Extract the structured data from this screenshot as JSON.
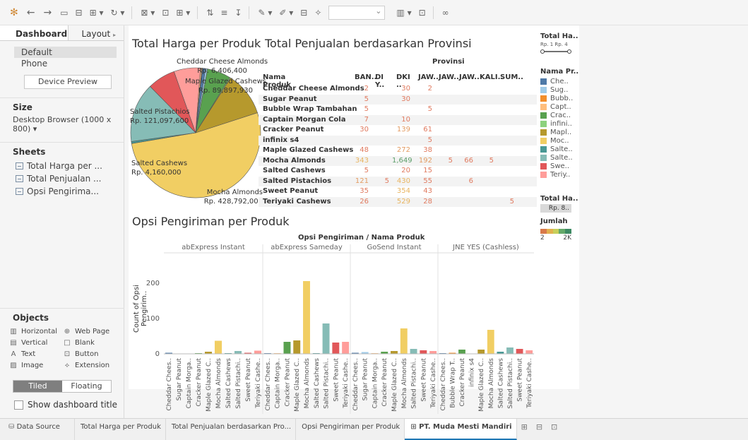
{
  "toolbar": {
    "icons": [
      "tableau-logo-icon",
      "back-icon",
      "forward-icon",
      "save-icon",
      "new-datasource-icon",
      "new-sheet-icon",
      "refresh-icon",
      "present-icon",
      "device-icon",
      "sort-icon",
      "highlight-icon",
      "pen-icon",
      "fit-icon",
      "show-me-icon",
      "share-icon"
    ]
  },
  "leftpane": {
    "tabs": {
      "dashboard": "Dashboard",
      "layout": "Layout"
    },
    "devices": [
      "Default",
      "Phone"
    ],
    "preview_button": "Device Preview",
    "size_label": "Size",
    "size_value": "Desktop Browser (1000 x 800) ▾",
    "sheets_label": "Sheets",
    "sheets": [
      "Total Harga per ...",
      "Total Penjualan ...",
      "Opsi Pengirima..."
    ],
    "objects_label": "Objects",
    "objects": [
      {
        "glyph": "▥",
        "label": "Horizontal"
      },
      {
        "glyph": "⊕",
        "label": "Web Page"
      },
      {
        "glyph": "▤",
        "label": "Vertical"
      },
      {
        "glyph": "□",
        "label": "Blank"
      },
      {
        "glyph": "A",
        "label": "Text"
      },
      {
        "glyph": "⊡",
        "label": "Button"
      },
      {
        "glyph": "▨",
        "label": "Image"
      },
      {
        "glyph": "⟡",
        "label": "Extension"
      }
    ],
    "tiled": "Tiled",
    "floating": "Floating",
    "show_title": "Show dashboard title"
  },
  "pie": {
    "title": "Total Harga per Produk",
    "labels": [
      {
        "name": "Cheddar Cheese Almonds",
        "value": "Rp. 6,406,400"
      },
      {
        "name": "Maple Glazed Cashews",
        "value": "Rp. 89,897,930"
      },
      {
        "name": "Salted Pistachios",
        "value": "Rp. 121,097,600"
      },
      {
        "name": "Salted Cashews",
        "value": "Rp. 4,160,000"
      },
      {
        "name": "Mocha Almonds",
        "value": "Rp. 428,792,000"
      }
    ]
  },
  "table": {
    "title": "Total Penjualan berdasarkan Provinsi",
    "col_group": "Provinsi",
    "row_header": "Nama Produk",
    "columns": [
      "BAN..",
      "DI Y..",
      "DKI ..",
      "JAW..",
      "JAW..",
      "JAW..",
      "KALI..",
      "SUM.."
    ],
    "rows": [
      {
        "name": "Cheddar Cheese Almonds",
        "cells": [
          "2",
          "",
          "30",
          "2",
          "",
          "",
          "",
          ""
        ]
      },
      {
        "name": "Sugar Peanut",
        "cells": [
          "5",
          "",
          "30",
          "",
          "",
          "",
          "",
          ""
        ]
      },
      {
        "name": "Bubble Wrap Tambahan",
        "cells": [
          "5",
          "",
          "",
          "5",
          "",
          "",
          "",
          ""
        ]
      },
      {
        "name": "Captain Morgan Cola",
        "cells": [
          "7",
          "",
          "10",
          "",
          "",
          "",
          "",
          ""
        ]
      },
      {
        "name": "Cracker Peanut",
        "cells": [
          "30",
          "",
          "139",
          "61",
          "",
          "",
          "",
          ""
        ]
      },
      {
        "name": "infinix s4",
        "cells": [
          "",
          "",
          "",
          "5",
          "",
          "",
          "",
          ""
        ]
      },
      {
        "name": "Maple Glazed Cashews",
        "cells": [
          "48",
          "",
          "272",
          "38",
          "",
          "",
          "",
          ""
        ]
      },
      {
        "name": "Mocha Almonds",
        "cells": [
          "343",
          "",
          "1,649",
          "192",
          "5",
          "66",
          "5",
          ""
        ]
      },
      {
        "name": "Salted Cashews",
        "cells": [
          "5",
          "",
          "20",
          "15",
          "",
          "",
          "",
          ""
        ]
      },
      {
        "name": "Salted Pistachios",
        "cells": [
          "121",
          "5",
          "430",
          "55",
          "",
          "6",
          "",
          ""
        ]
      },
      {
        "name": "Sweet Peanut",
        "cells": [
          "35",
          "",
          "354",
          "43",
          "",
          "",
          "",
          ""
        ]
      },
      {
        "name": "Teriyaki Cashews",
        "cells": [
          "26",
          "",
          "529",
          "28",
          "",
          "",
          "",
          "5"
        ]
      }
    ]
  },
  "bar": {
    "title": "Opsi Pengiriman per Produk",
    "header": "Opsi Pengiriman / Nama Produk",
    "ylabel": "Count of Opsi Pengirim..",
    "yticks": [
      "0",
      "100",
      "200"
    ]
  },
  "legends": {
    "total_harga_title": "Total Ha..",
    "range_label": "Rp. 1 Rp. 4",
    "nama_produk_title": "Nama Pr..",
    "items": [
      {
        "label": "Che..",
        "color": "#4e79a7"
      },
      {
        "label": "Sug..",
        "color": "#a0cbe8"
      },
      {
        "label": "Bubb..",
        "color": "#f28e2b"
      },
      {
        "label": "Capt..",
        "color": "#ffbe7d"
      },
      {
        "label": "Crac..",
        "color": "#59a14f"
      },
      {
        "label": "infini..",
        "color": "#8cd17d"
      },
      {
        "label": "Mapl..",
        "color": "#b6992d"
      },
      {
        "label": "Moc..",
        "color": "#f1ce63"
      },
      {
        "label": "Salte..",
        "color": "#499894"
      },
      {
        "label": "Salte..",
        "color": "#86bcb6"
      },
      {
        "label": "Swe..",
        "color": "#e15759"
      },
      {
        "label": "Teriy..",
        "color": "#ff9d9a"
      }
    ],
    "total_harga2_title": "Total Ha..",
    "total_harga2_value": "Rp. 8..",
    "jumlah_title": "Jumlah",
    "jumlah_min": "2",
    "jumlah_max": "2K"
  },
  "bottom_tabs": {
    "datasource": "Data Source",
    "tabs": [
      "Total Harga per Produk",
      "Total Penjualan berdasarkan Pro...",
      "Opsi Pengiriman per Produk"
    ],
    "active": "PT. Muda Mesti Mandiri"
  },
  "chart_data": [
    {
      "type": "pie",
      "title": "Total Harga per Produk",
      "slices": [
        {
          "name": "Mocha Almonds",
          "value": 428792000,
          "color": "#f1ce63"
        },
        {
          "name": "Salted Cashews",
          "value": 4160000,
          "color": "#499894"
        },
        {
          "name": "Salted Pistachios",
          "value": 121097600,
          "color": "#86bcb6"
        },
        {
          "name": "Sweet Peanut",
          "value": 57000000,
          "color": "#e15759"
        },
        {
          "name": "Teriyaki Cashews",
          "value": 54000000,
          "color": "#ff9d9a"
        },
        {
          "name": "Captain Morgan Cola",
          "value": 2800000,
          "color": "#ffbe7d"
        },
        {
          "name": "Bubble Wrap Tambahan",
          "value": 1200000,
          "color": "#f28e2b"
        },
        {
          "name": "Cheddar Cheese Almonds",
          "value": 6406400,
          "color": "#4e79a7"
        },
        {
          "name": "Sugar Peanut",
          "value": 3800000,
          "color": "#a0cbe8"
        },
        {
          "name": "Cracker Peanut",
          "value": 48000000,
          "color": "#59a14f"
        },
        {
          "name": "infinix s4",
          "value": 2000000,
          "color": "#8cd17d"
        },
        {
          "name": "Maple Glazed Cashews",
          "value": 89897930,
          "color": "#b6992d"
        }
      ]
    },
    {
      "type": "bar",
      "title": "Opsi Pengiriman per Produk",
      "ylabel": "Count of Opsi Pengirim..",
      "ylim": [
        0,
        220
      ],
      "panels": [
        {
          "name": "abExpress Instant",
          "categories": [
            "Cheddar Chees..",
            "Sugar Peanut",
            "Captain Morga..",
            "Cracker Peanut",
            "Maple Glazed C..",
            "Mocha Almonds",
            "Salted Cashews",
            "Salted Pistachi..",
            "Sweet Peanut",
            "Teriyaki Cashe.."
          ],
          "values": [
            3,
            1,
            1,
            2,
            6,
            37,
            2,
            8,
            3,
            9
          ],
          "colors": [
            "#4e79a7",
            "#a0cbe8",
            "#ffbe7d",
            "#59a14f",
            "#b6992d",
            "#f1ce63",
            "#499894",
            "#86bcb6",
            "#e15759",
            "#ff9d9a"
          ]
        },
        {
          "name": "abExpress Sameday",
          "categories": [
            "Cheddar Chees..",
            "Captain Morga..",
            "Cracker Peanut",
            "Maple Glazed C..",
            "Mocha Almonds",
            "Salted Cashews",
            "Salted Pistachi..",
            "Sweet Peanut",
            "Teriyaki Cashe.."
          ],
          "values": [
            2,
            2,
            34,
            38,
            206,
            2,
            86,
            32,
            34
          ],
          "colors": [
            "#4e79a7",
            "#ffbe7d",
            "#59a14f",
            "#b6992d",
            "#f1ce63",
            "#499894",
            "#86bcb6",
            "#e15759",
            "#ff9d9a"
          ]
        },
        {
          "name": "GoSend Instant",
          "categories": [
            "Cheddar Chees..",
            "Sugar Peanut",
            "Captain Morga..",
            "Cracker Peanut",
            "Maple Glazed C..",
            "Mocha Almonds",
            "Salted Pistachi..",
            "Sweet Peanut",
            "Teriyaki Cashe.."
          ],
          "values": [
            3,
            5,
            2,
            6,
            8,
            72,
            14,
            10,
            8
          ],
          "colors": [
            "#4e79a7",
            "#a0cbe8",
            "#ffbe7d",
            "#59a14f",
            "#b6992d",
            "#f1ce63",
            "#86bcb6",
            "#e15759",
            "#ff9d9a"
          ]
        },
        {
          "name": "JNE YES (Cashless)",
          "categories": [
            "Cheddar Chees..",
            "Bubble Wrap T..",
            "Cracker Peanut",
            "infinix s4",
            "Maple Glazed C..",
            "Mocha Almonds",
            "Salted Cashews",
            "Salted Pistachi..",
            "Sweet Peanut",
            "Teriyaki Cashe.."
          ],
          "values": [
            2,
            3,
            12,
            1,
            12,
            68,
            6,
            18,
            14,
            10
          ],
          "colors": [
            "#4e79a7",
            "#f28e2b",
            "#59a14f",
            "#8cd17d",
            "#b6992d",
            "#f1ce63",
            "#499894",
            "#86bcb6",
            "#e15759",
            "#ff9d9a"
          ]
        }
      ]
    }
  ]
}
